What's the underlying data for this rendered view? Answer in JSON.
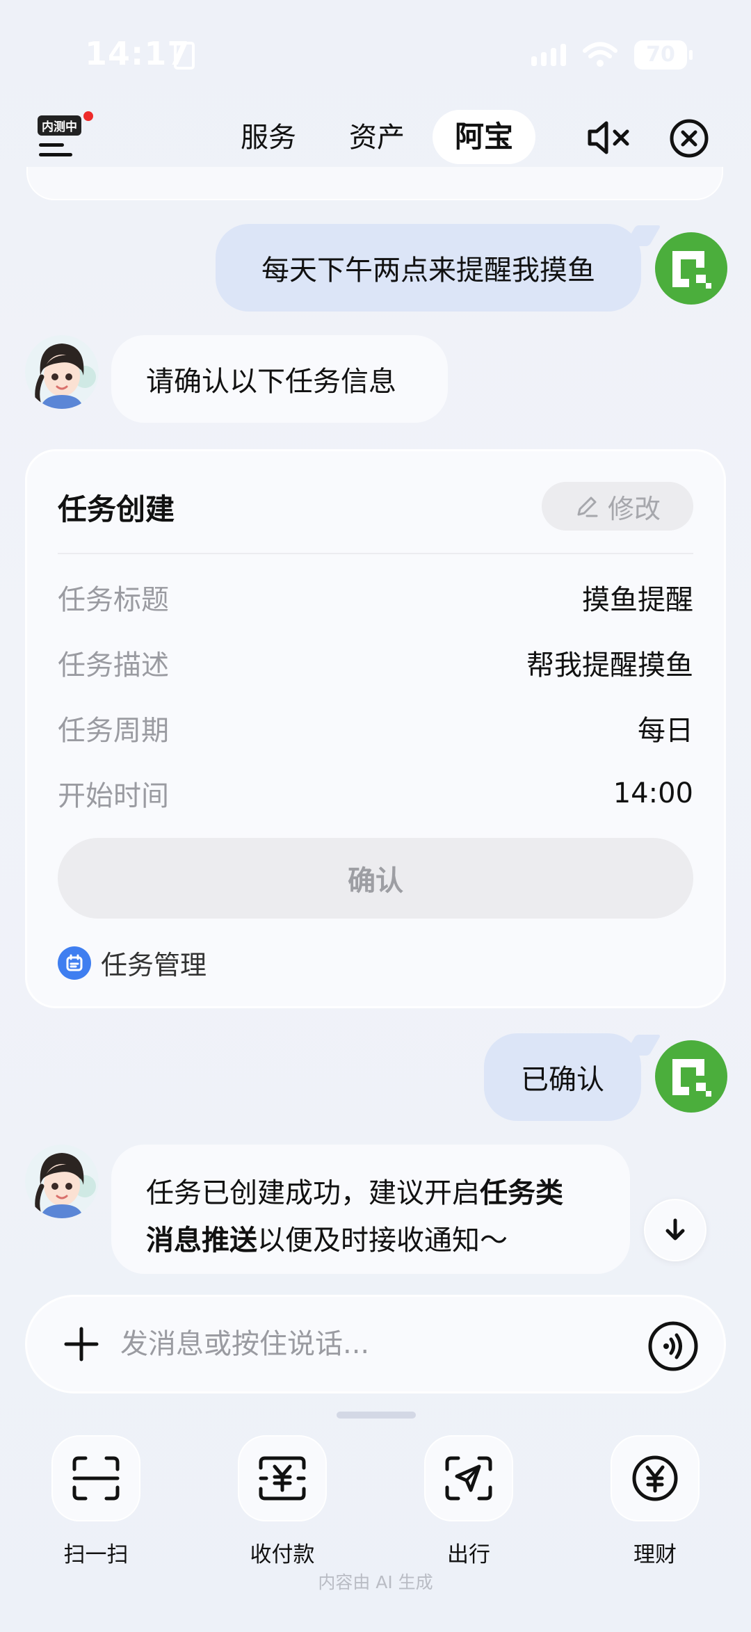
{
  "status_bar": {
    "time": "14:17",
    "battery": "70"
  },
  "header": {
    "beta_badge": "内测中",
    "tabs": [
      {
        "label": "服务"
      },
      {
        "label": "资产"
      },
      {
        "label": "阿宝",
        "active": true
      }
    ],
    "icons": [
      "menu-icon",
      "mute-icon",
      "close-icon"
    ]
  },
  "chat": {
    "user_msg_1": "每天下午两点来提醒我摸鱼",
    "ai_msg_1": "请确认以下任务信息",
    "task_card": {
      "title": "任务创建",
      "edit_label": "修改",
      "rows": [
        {
          "key": "任务标题",
          "value": "摸鱼提醒"
        },
        {
          "key": "任务描述",
          "value": "帮我提醒摸鱼"
        },
        {
          "key": "任务周期",
          "value": "每日"
        },
        {
          "key": "开始时间",
          "value": "14:00"
        }
      ],
      "confirm_label": "确认",
      "task_manage_label": "任务管理"
    },
    "user_msg_2": "已确认",
    "ai_msg_2": {
      "part1": "任务已创建成功，建议开启",
      "bold1": "任务类",
      "bold2": "消息推送",
      "part2": "以便及时接收通知～"
    }
  },
  "input": {
    "placeholder": "发消息或按住说话..."
  },
  "shortcuts": [
    {
      "label": "扫一扫",
      "icon": "scan-icon"
    },
    {
      "label": "收付款",
      "icon": "payment-icon"
    },
    {
      "label": "出行",
      "icon": "travel-icon"
    },
    {
      "label": "理财",
      "icon": "wealth-icon"
    }
  ],
  "footer_note": "内容由 AI 生成",
  "colors": {
    "user_avatar": "#4bae3c",
    "user_bubble": "#dce5f7",
    "task_manage_icon": "#3f7ef0",
    "badge_dot": "#ee2b2b"
  }
}
